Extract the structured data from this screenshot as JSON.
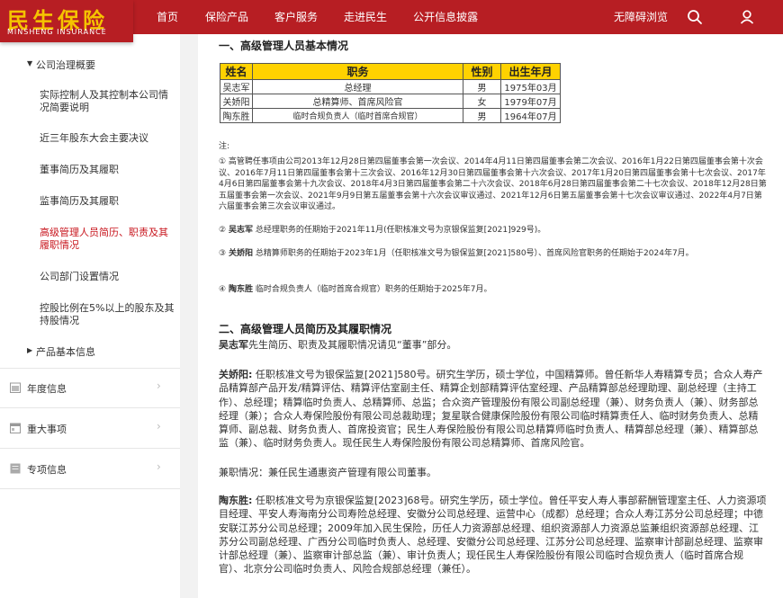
{
  "header": {
    "logo_cn": "民生保险",
    "logo_en": "MINSHENG INSURANCE",
    "nav": [
      "首页",
      "保险产品",
      "客户服务",
      "走进民生",
      "公开信息披露"
    ],
    "accessible_label": "无障碍浏览",
    "icons": [
      "search-icon",
      "user-icon"
    ]
  },
  "sidebar": {
    "governance_title": "公司治理概要",
    "sub_items": [
      "实际控制人及其控制本公司情况简要说明",
      "近三年股东大会主要决议",
      "董事简历及其履职",
      "监事简历及其履职",
      "高级管理人员简历、职责及其履职情况",
      "公司部门设置情况",
      "控股比例在5%以上的股东及其持股情况"
    ],
    "products_title": "产品基本信息",
    "main_items": [
      "年度信息",
      "重大事项",
      "专项信息"
    ],
    "active_color": "#c8161e"
  },
  "content": {
    "section1_title": "一、高级管理人员基本情况",
    "table": {
      "headers": [
        "姓名",
        "职务",
        "性别",
        "出生年月"
      ],
      "rows": [
        [
          "吴志军",
          "总经理",
          "男",
          "1975年03月"
        ],
        [
          "关娇阳",
          "总精算师、首席风险官",
          "女",
          "1979年07月"
        ],
        [
          "陶东胜",
          "临时合规负责人（临时首席合规官）",
          "男",
          "1964年07月"
        ]
      ]
    },
    "note_label": "注:",
    "notes": {
      "n1": "① 高管聘任事项由公司2013年12月28日第四届董事会第一次会议、2014年4月11日第四届董事会第二次会议、2016年1月22日第四届董事会第十次会议、2016年7月11日第四届董事会第十三次会议、2016年12月30日第四届董事会第十六次会议、2017年1月20日第四届董事会第十七次会议、2017年4月6日第四届董事会第十九次会议、2018年4月3日第四届董事会第二十六次会议、2018年6月28日第四届董事会第二十七次会议、2018年12月28日第五届董事会第一次会议、2021年9月9日第五届董事会第十六次会议审议通过、2021年12月6日第五届董事会第十七次会议审议通过、2022年4月7日第六届董事会第三次会议审议通过。",
      "n2_prefix": "② ",
      "n2_name": "吴志军",
      "n2_text": " 总经理职务的任期始于2021年11月(任职核准文号为京银保监复[2021]929号)。",
      "n3_prefix": "③ ",
      "n3_name": "关娇阳",
      "n3_text": " 总精算师职务的任期始于2023年1月（任职核准文号为银保监复[2021]580号）、首席风险官职务的任期始于2024年7月。",
      "n4_prefix": "④ ",
      "n4_name": "陶东胜",
      "n4_text": " 临时合规负责人（临时首席合规官）职务的任期始于2025年7月。"
    },
    "section2_title": "二、高级管理人员简历及其履职情况",
    "wu_name": "吴志军",
    "wu_text": "先生简历、职责及其履职情况请见“董事”部分。",
    "guan_name": "关娇阳:",
    "guan_text": " 任职核准文号为银保监复[2021]580号。研究生学历，硕士学位，中国精算师。曾任新华人寿精算专员；合众人寿产品精算部产品开发/精算评估、精算评估室副主任、精算企划部精算评估室经理、产品精算部总经理助理、副总经理（主持工作）、总经理；精算临时负责人、总精算师、总监；合众资产管理股份有限公司副总经理（兼）、财务负责人（兼）、财务部总经理（兼）；合众人寿保险股份有限公司总裁助理；复星联合健康保险股份有限公司临时精算责任人、临时财务负责人、总精算师、副总裁、财务负责人、首席投资官；民生人寿保险股份有限公司总精算师临时负责人、精算部总经理（兼）、精算部总监（兼）、临时财务负责人。现任民生人寿保险股份有限公司总精算师、首席风险官。",
    "guan_extra": "兼职情况：兼任民生通惠资产管理有限公司董事。",
    "tao_name": "陶东胜:",
    "tao_text": " 任职核准文号为京银保监复[2023]68号。研究生学历，硕士学位。曾任平安人寿人事部薪酬管理室主任、人力资源项目经理、平安人寿海南分公司寿险总经理、安徽分公司总经理、运营中心（成都）总经理；合众人寿江苏分公司总经理；中德安联江苏分公司总经理；2009年加入民生保险，历任人力资源部总经理、组织资源部人力资源总监兼组织资源部总经理、江苏分公司副总经理、广西分公司临时负责人、总经理、安徽分公司总经理、江苏分公司总经理、监察审计部副总经理、监察审计部总经理（兼）、监察审计部总监（兼）、审计负责人；现任民生人寿保险股份有限公司临时合规负责人（临时首席合规官）、北京分公司临时负责人、风险合规部总经理（兼任）。"
  }
}
